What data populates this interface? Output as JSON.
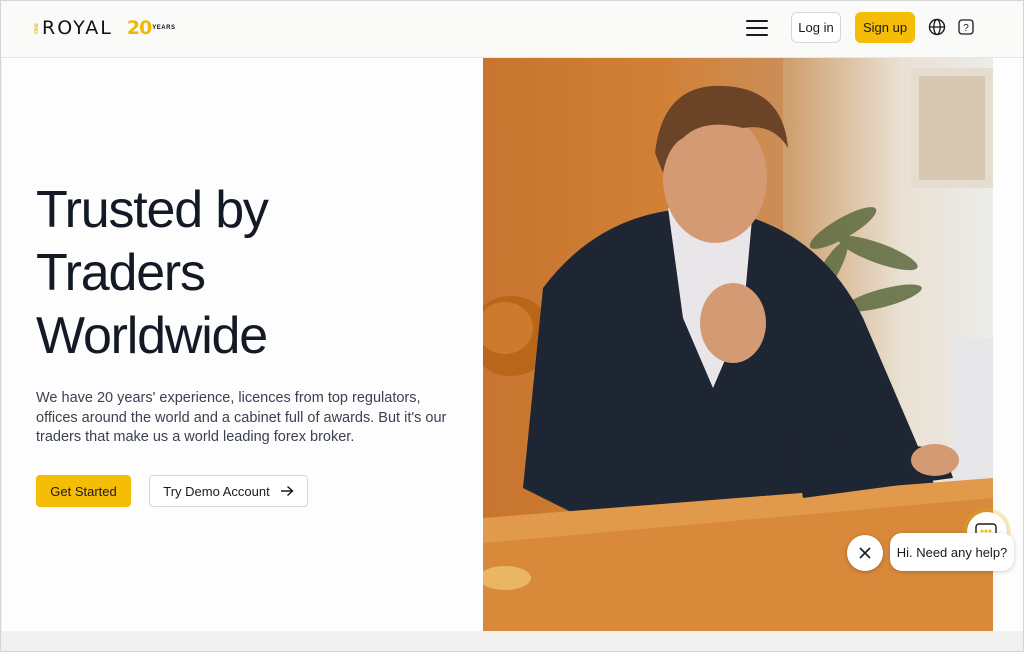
{
  "header": {
    "logo": {
      "small": "ONE",
      "word": "ROYAL",
      "anniv_num": "20",
      "anniv_label": "YEARS"
    },
    "login_label": "Log in",
    "signup_label": "Sign up",
    "icons": {
      "menu": "hamburger-menu-icon",
      "globe": "globe-icon",
      "help": "help-icon"
    }
  },
  "hero": {
    "headline": [
      "Trusted by",
      "Traders",
      "Worldwide"
    ],
    "subtext": "We have 20 years' experience, licences from top regulators, offices around the world and a cabinet full of awards. But it's our traders that make us a world leading forex broker.",
    "cta_primary": "Get Started",
    "cta_secondary": "Try Demo Account"
  },
  "chat": {
    "bubble": "Hi. Need any help?",
    "icons": {
      "close": "close-icon",
      "launcher": "chat-icon"
    }
  },
  "colors": {
    "accent": "#f5bd06",
    "text": "#131a26"
  }
}
